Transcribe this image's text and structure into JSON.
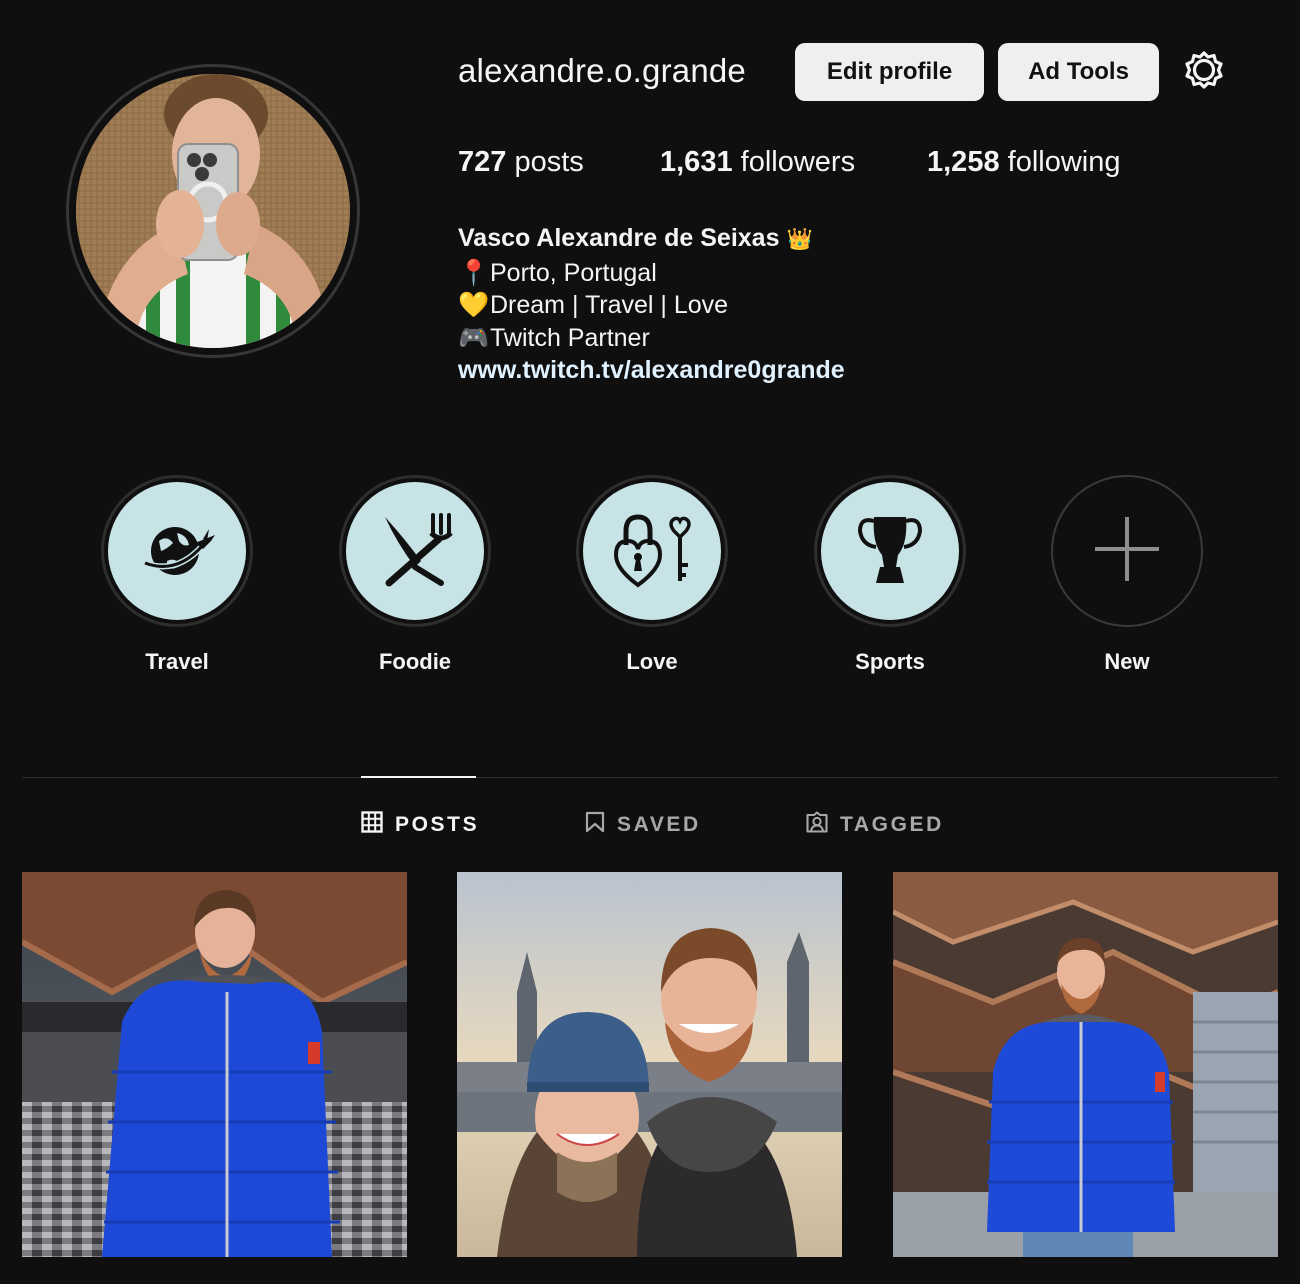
{
  "profile": {
    "username": "alexandre.o.grande",
    "edit_profile_label": "Edit profile",
    "ad_tools_label": "Ad Tools",
    "settings_icon": "gear-icon"
  },
  "stats": {
    "posts_count": "727",
    "posts_label": " posts",
    "followers_count": "1,631",
    "followers_label": " followers",
    "following_count": "1,258",
    "following_label": " following"
  },
  "bio": {
    "name": "Vasco Alexandre de Seixas",
    "name_emoji": "👑",
    "lines": [
      {
        "emoji": "📍",
        "text": "Porto, Portugal"
      },
      {
        "emoji": "💛",
        "text": "Dream | Travel | Love"
      },
      {
        "emoji": "🎮",
        "text": "Twitch Partner"
      }
    ],
    "link": "www.twitch.tv/alexandre0grande"
  },
  "highlights": [
    {
      "label": "Travel",
      "icon": "globe-plane-icon"
    },
    {
      "label": "Foodie",
      "icon": "knife-fork-icon"
    },
    {
      "label": "Love",
      "icon": "heart-lock-key-icon"
    },
    {
      "label": "Sports",
      "icon": "trophy-icon"
    },
    {
      "label": "New",
      "icon": "plus-icon"
    }
  ],
  "tabs": [
    {
      "label": "POSTS",
      "icon": "grid-icon",
      "active": true
    },
    {
      "label": "SAVED",
      "icon": "bookmark-icon",
      "active": false
    },
    {
      "label": "TAGGED",
      "icon": "tagged-user-icon",
      "active": false
    }
  ],
  "colors": {
    "background": "#0f0f10",
    "button_bg": "#efefef",
    "highlight_bg": "#c7e3e6",
    "link": "#e0f1ff"
  }
}
